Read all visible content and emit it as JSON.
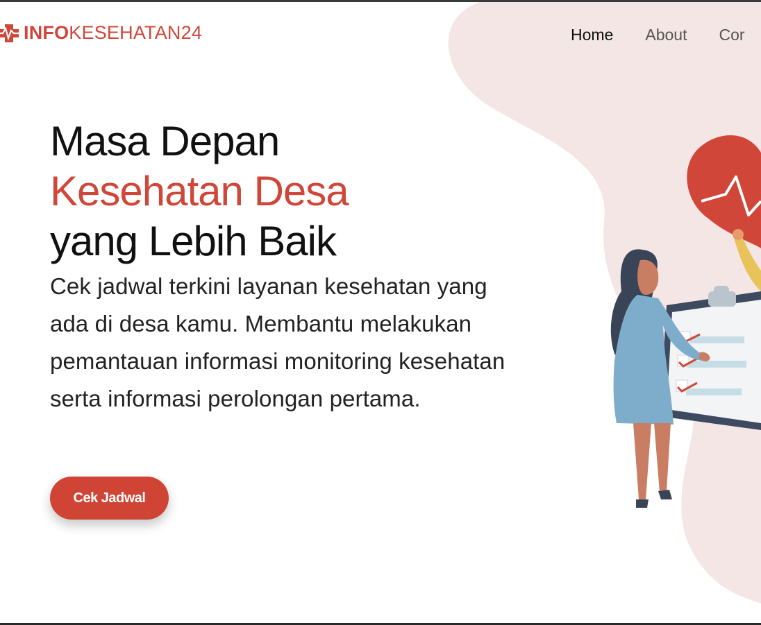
{
  "brand": {
    "bold": "INFO",
    "light": "KESEHATAN24",
    "logo_icon": "heartbeat-cross-icon"
  },
  "nav": {
    "items": [
      {
        "label": "Home",
        "active": true
      },
      {
        "label": "About",
        "active": false
      },
      {
        "label": "Cor",
        "active": false
      }
    ]
  },
  "hero": {
    "title_line1": "Masa Depan",
    "title_line2": "Kesehatan Desa",
    "title_line3": "yang Lebih Baik",
    "description": "Cek jadwal terkini layanan kesehatan yang ada di desa kamu. Membantu melakukan pemantauan informasi monitoring kesehatan serta informasi perolongan pertama.",
    "cta_label": "Cek Jadwal"
  },
  "illustration": {
    "name": "doctor-with-clipboard-and-heart-illustration"
  },
  "colors": {
    "accent": "#d0473a",
    "blob": "#f3e6e4",
    "text": "#111111",
    "nav_muted": "#555555"
  }
}
